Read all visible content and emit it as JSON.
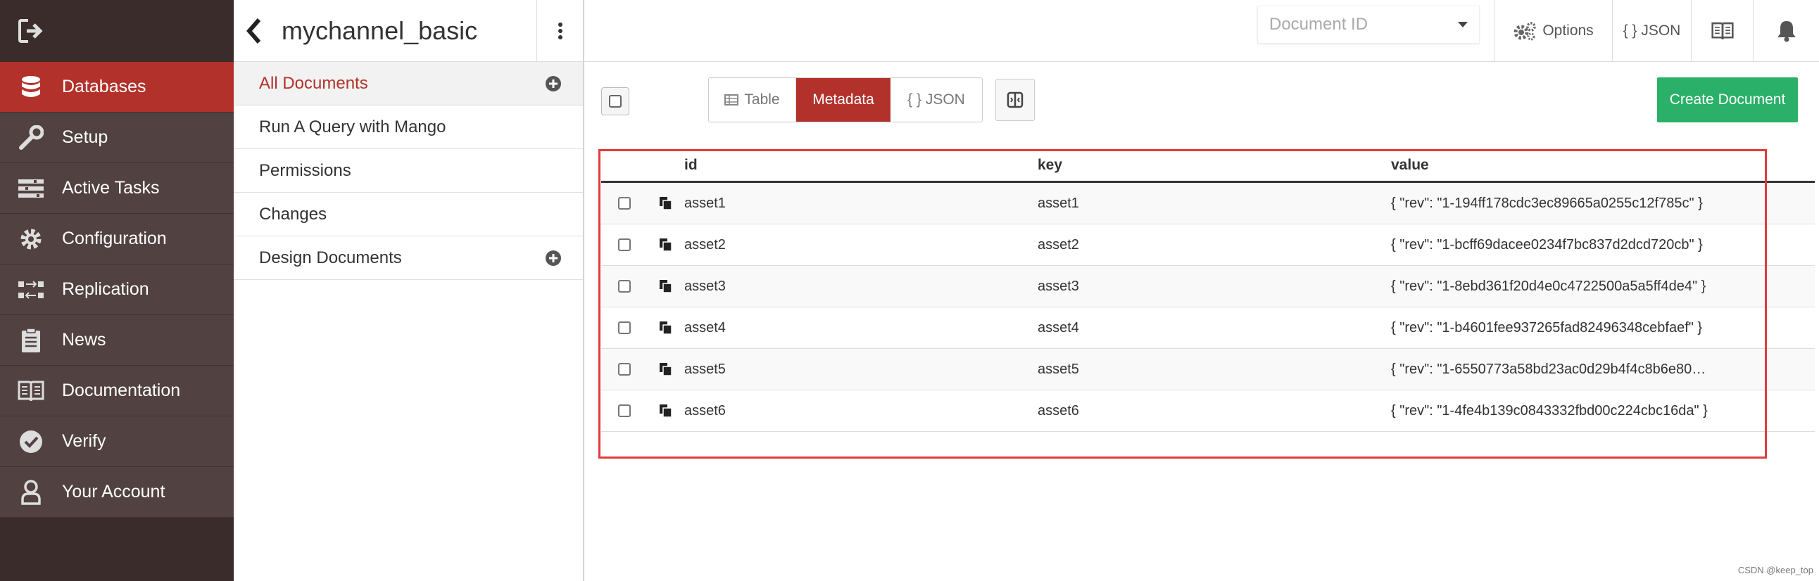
{
  "nav": {
    "items": [
      {
        "label": "Databases",
        "icon": "database-icon",
        "active": true
      },
      {
        "label": "Setup",
        "icon": "wrench-icon",
        "active": false
      },
      {
        "label": "Active Tasks",
        "icon": "tasks-icon",
        "active": false
      },
      {
        "label": "Configuration",
        "icon": "gear-icon",
        "active": false
      },
      {
        "label": "Replication",
        "icon": "replication-icon",
        "active": false
      },
      {
        "label": "News",
        "icon": "clipboard-icon",
        "active": false
      },
      {
        "label": "Documentation",
        "icon": "book-icon",
        "active": false
      },
      {
        "label": "Verify",
        "icon": "check-circle-icon",
        "active": false
      },
      {
        "label": "Your Account",
        "icon": "user-icon",
        "active": false
      }
    ]
  },
  "sidebar": {
    "title": "mychannel_basic",
    "items": [
      {
        "label": "All Documents",
        "active": true,
        "has_add": true
      },
      {
        "label": "Run A Query with Mango",
        "active": false,
        "has_add": false
      },
      {
        "label": "Permissions",
        "active": false,
        "has_add": false
      },
      {
        "label": "Changes",
        "active": false,
        "has_add": false
      },
      {
        "label": "Design Documents",
        "active": false,
        "has_add": true
      }
    ]
  },
  "header": {
    "doc_id_placeholder": "Document ID",
    "options_label": "Options",
    "json_label": "{ } JSON"
  },
  "toolbar": {
    "view_tabs": [
      {
        "label": "Table",
        "active": false
      },
      {
        "label": "Metadata",
        "active": true
      },
      {
        "label": "{ } JSON",
        "active": false
      }
    ],
    "create_label": "Create Document"
  },
  "table": {
    "columns": [
      "id",
      "key",
      "value"
    ],
    "rows": [
      {
        "id": "asset1",
        "key": "asset1",
        "value": "{ \"rev\": \"1-194ff178cdc3ec89665a0255c12f785c\" }"
      },
      {
        "id": "asset2",
        "key": "asset2",
        "value": "{ \"rev\": \"1-bcff69dacee0234f7bc837d2dcd720cb\" }"
      },
      {
        "id": "asset3",
        "key": "asset3",
        "value": "{ \"rev\": \"1-8ebd361f20d4e0c4722500a5a5ff4de4\" }"
      },
      {
        "id": "asset4",
        "key": "asset4",
        "value": "{ \"rev\": \"1-b4601fee937265fad82496348cebfaef\" }"
      },
      {
        "id": "asset5",
        "key": "asset5",
        "value": "{ \"rev\": \"1-6550773a58bd23ac0d29b4f4c8b6e80…"
      },
      {
        "id": "asset6",
        "key": "asset6",
        "value": "{ \"rev\": \"1-4fe4b139c0843332fbd00c224cbc16da\" }"
      }
    ]
  },
  "watermark": "CSDN @keep_top",
  "colors": {
    "accent": "#b2322b",
    "nav_bg": "#514241",
    "create": "#2ab068",
    "highlight": "#e23b3b"
  }
}
